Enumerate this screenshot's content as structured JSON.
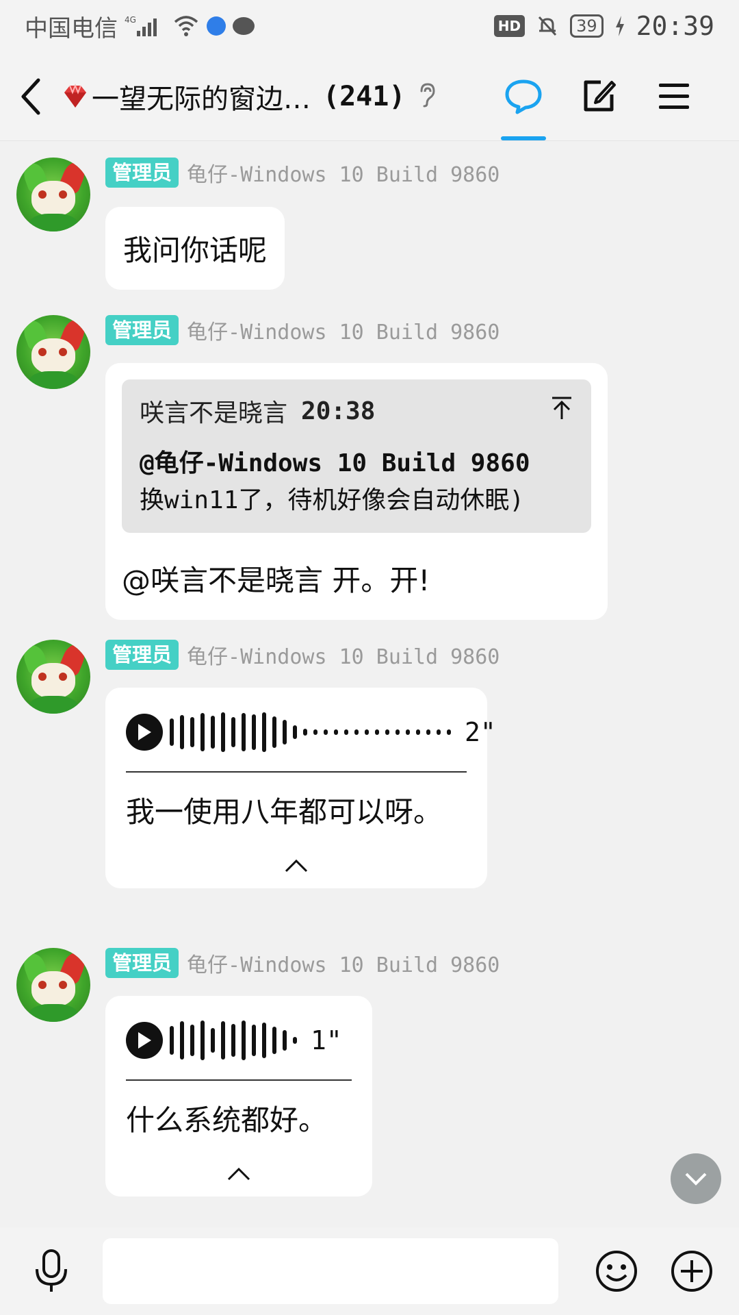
{
  "status_bar": {
    "carrier": "中国电信",
    "network": "4G",
    "hd": "HD",
    "battery": "39",
    "time": "20:39"
  },
  "header": {
    "title": "一望无际的窗边…",
    "member_count": "(241)",
    "accent_color": "#1aa3f0"
  },
  "messages": [
    {
      "role": "管理员",
      "sender": "龟仔-Windows 10 Build 9860",
      "text": "我问你话呢"
    },
    {
      "role": "管理员",
      "sender": "龟仔-Windows 10 Build 9860",
      "quote": {
        "author": "咲言不是晓言",
        "time": "20:38",
        "line1": "@龟仔-Windows 10 Build 9860",
        "line2": "换win11了，待机好像会自动休眠)"
      },
      "text": "@咲言不是晓言  开。开!"
    },
    {
      "role": "管理员",
      "sender": "龟仔-Windows 10 Build 9860",
      "voice_duration": "2\"",
      "transcript": "我一使用八年都可以呀。"
    },
    {
      "role": "管理员",
      "sender": "龟仔-Windows 10 Build 9860",
      "voice_duration": "1\"",
      "transcript": "什么系统都好。"
    }
  ],
  "input": {
    "placeholder": ""
  },
  "colors": {
    "role_badge": "#45d0c5",
    "background": "#f1f1f1"
  }
}
